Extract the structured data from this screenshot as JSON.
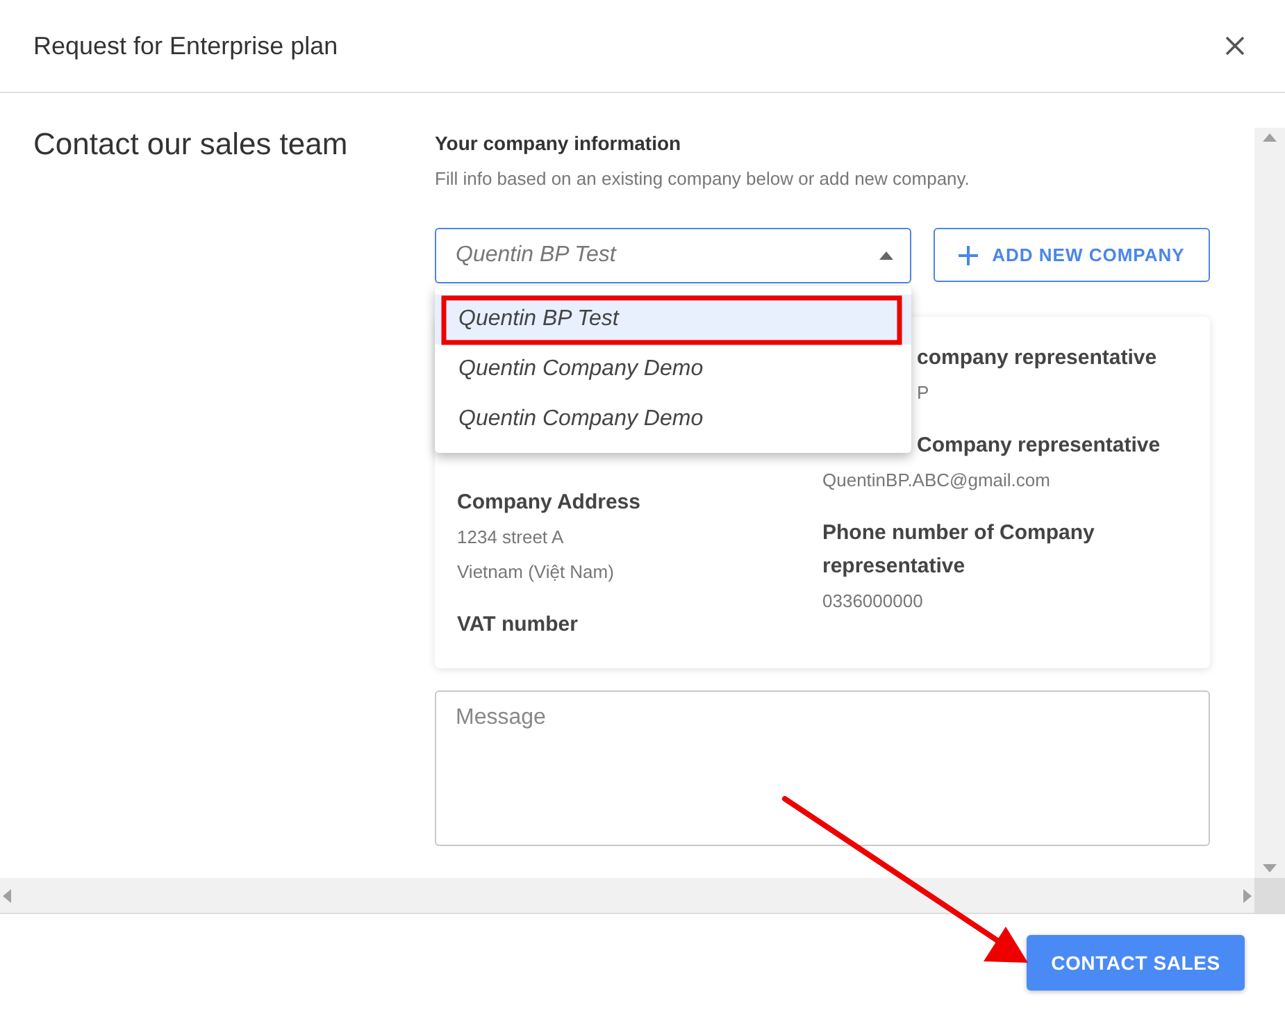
{
  "dialog": {
    "title": "Request for Enterprise plan"
  },
  "heading": "Contact our sales team",
  "section": {
    "title": "Your company information",
    "subtitle": "Fill info based on an existing company below or add new company."
  },
  "company_select": {
    "value": "Quentin BP Test",
    "expanded": true,
    "options": [
      {
        "label": "Quentin BP Test",
        "selected": true
      },
      {
        "label": "Quentin Company Demo",
        "selected": false
      },
      {
        "label": "Quentin Company Demo",
        "selected": false
      }
    ]
  },
  "add_button": {
    "label": "ADD NEW COMPANY"
  },
  "details": {
    "left": [
      {
        "kind": "label",
        "text": "Company Address"
      },
      {
        "kind": "value",
        "text": "1234 street A"
      },
      {
        "kind": "value",
        "text": "Vietnam (Việt Nam)"
      },
      {
        "kind": "label",
        "text": "VAT number"
      }
    ],
    "right": [
      {
        "kind": "cutlabel",
        "text": "company representative"
      },
      {
        "kind": "cutvalue",
        "text": "P"
      },
      {
        "kind": "cutlabel",
        "text": "Company representative"
      },
      {
        "kind": "value",
        "text": "QuentinBP.ABC@gmail.com"
      },
      {
        "kind": "label",
        "text": "Phone number of Company representative"
      },
      {
        "kind": "value",
        "text": "0336000000"
      }
    ]
  },
  "message": {
    "placeholder": "Message"
  },
  "submit_button": {
    "label": "CONTACT SALES"
  }
}
